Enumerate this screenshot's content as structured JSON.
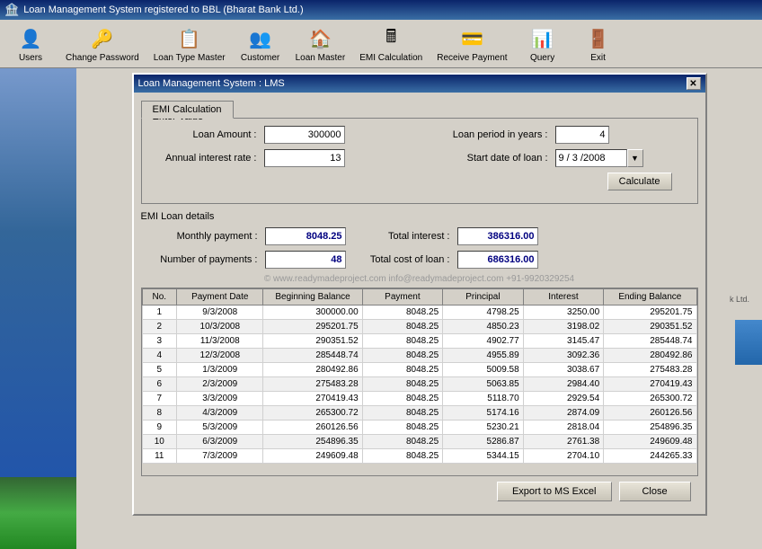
{
  "titlebar": {
    "title": "Loan Management System registered to BBL (Bharat Bank Ltd.)",
    "icon": "🏦"
  },
  "toolbar": {
    "buttons": [
      {
        "id": "users",
        "label": "Users",
        "icon": "👤"
      },
      {
        "id": "change-password",
        "label": "Change Password",
        "icon": "🔑"
      },
      {
        "id": "loan-type-master",
        "label": "Loan Type Master",
        "icon": "📋"
      },
      {
        "id": "customer",
        "label": "Customer",
        "icon": "👥"
      },
      {
        "id": "loan-master",
        "label": "Loan Master",
        "icon": "🏠"
      },
      {
        "id": "emi-calculation",
        "label": "EMI Calculation",
        "icon": "🖩"
      },
      {
        "id": "receive-payment",
        "label": "Receive Payment",
        "icon": "💳"
      },
      {
        "id": "query",
        "label": "Query",
        "icon": "📊"
      },
      {
        "id": "exit",
        "label": "Exit",
        "icon": "🚪"
      }
    ]
  },
  "dialog": {
    "title": "Loan Management System : LMS",
    "tab": "EMI Calculation",
    "enter_value_group": "Enter Value",
    "loan_amount_label": "Loan Amount :",
    "loan_amount_value": "300000",
    "loan_period_label": "Loan period in years :",
    "loan_period_value": "4",
    "annual_rate_label": "Annual interest rate :",
    "annual_rate_value": "13",
    "start_date_label": "Start date of loan :",
    "start_date_value": "9 / 3 /2008",
    "calculate_btn": "Calculate",
    "emi_details_label": "EMI Loan details",
    "monthly_payment_label": "Monthly payment :",
    "monthly_payment_value": "8048.25",
    "total_interest_label": "Total interest :",
    "total_interest_value": "386316.00",
    "number_payments_label": "Number of payments :",
    "number_payments_value": "48",
    "total_cost_label": "Total cost of loan :",
    "total_cost_value": "686316.00",
    "watermark": "© www.readymadeproject.com  info@readymadeproject.com  +91-9920329254",
    "table": {
      "headers": [
        "No.",
        "Payment Date",
        "Beginning Balance",
        "Payment",
        "Principal",
        "Interest",
        "Ending Balance"
      ],
      "rows": [
        [
          "1",
          "9/3/2008",
          "300000.00",
          "8048.25",
          "4798.25",
          "3250.00",
          "295201.75"
        ],
        [
          "2",
          "10/3/2008",
          "295201.75",
          "8048.25",
          "4850.23",
          "3198.02",
          "290351.52"
        ],
        [
          "3",
          "11/3/2008",
          "290351.52",
          "8048.25",
          "4902.77",
          "3145.47",
          "285448.74"
        ],
        [
          "4",
          "12/3/2008",
          "285448.74",
          "8048.25",
          "4955.89",
          "3092.36",
          "280492.86"
        ],
        [
          "5",
          "1/3/2009",
          "280492.86",
          "8048.25",
          "5009.58",
          "3038.67",
          "275483.28"
        ],
        [
          "6",
          "2/3/2009",
          "275483.28",
          "8048.25",
          "5063.85",
          "2984.40",
          "270419.43"
        ],
        [
          "7",
          "3/3/2009",
          "270419.43",
          "8048.25",
          "5118.70",
          "2929.54",
          "265300.72"
        ],
        [
          "8",
          "4/3/2009",
          "265300.72",
          "8048.25",
          "5174.16",
          "2874.09",
          "260126.56"
        ],
        [
          "9",
          "5/3/2009",
          "260126.56",
          "8048.25",
          "5230.21",
          "2818.04",
          "254896.35"
        ],
        [
          "10",
          "6/3/2009",
          "254896.35",
          "8048.25",
          "5286.87",
          "2761.38",
          "249609.48"
        ],
        [
          "11",
          "7/3/2009",
          "249609.48",
          "8048.25",
          "5344.15",
          "2704.10",
          "244265.33"
        ]
      ]
    },
    "export_btn": "Export to MS Excel",
    "close_btn": "Close"
  }
}
